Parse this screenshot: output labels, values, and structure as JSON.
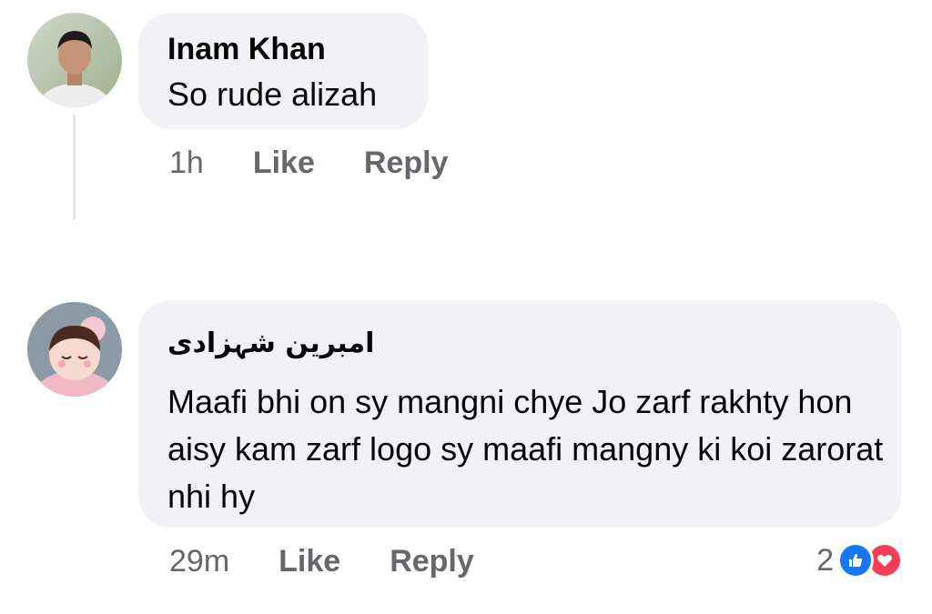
{
  "comments": [
    {
      "author": "Inam Khan",
      "text": "So rude alizah",
      "time": "1h",
      "like_label": "Like",
      "reply_label": "Reply"
    },
    {
      "author": "امبرین شہزادی",
      "text": "Maafi bhi on sy mangni chye Jo zarf rakhty hon aisy kam zarf logo sy maafi mangny ki koi zarorat nhi hy",
      "time": "29m",
      "like_label": "Like",
      "reply_label": "Reply",
      "reaction_count": "2",
      "reaction_icons": [
        "like-icon",
        "love-icon"
      ]
    }
  ],
  "colors": {
    "bubble_bg": "#f0f2f5",
    "meta_text": "#65676b",
    "like_blue": "#1877f2",
    "love_red": "#f33e58"
  }
}
